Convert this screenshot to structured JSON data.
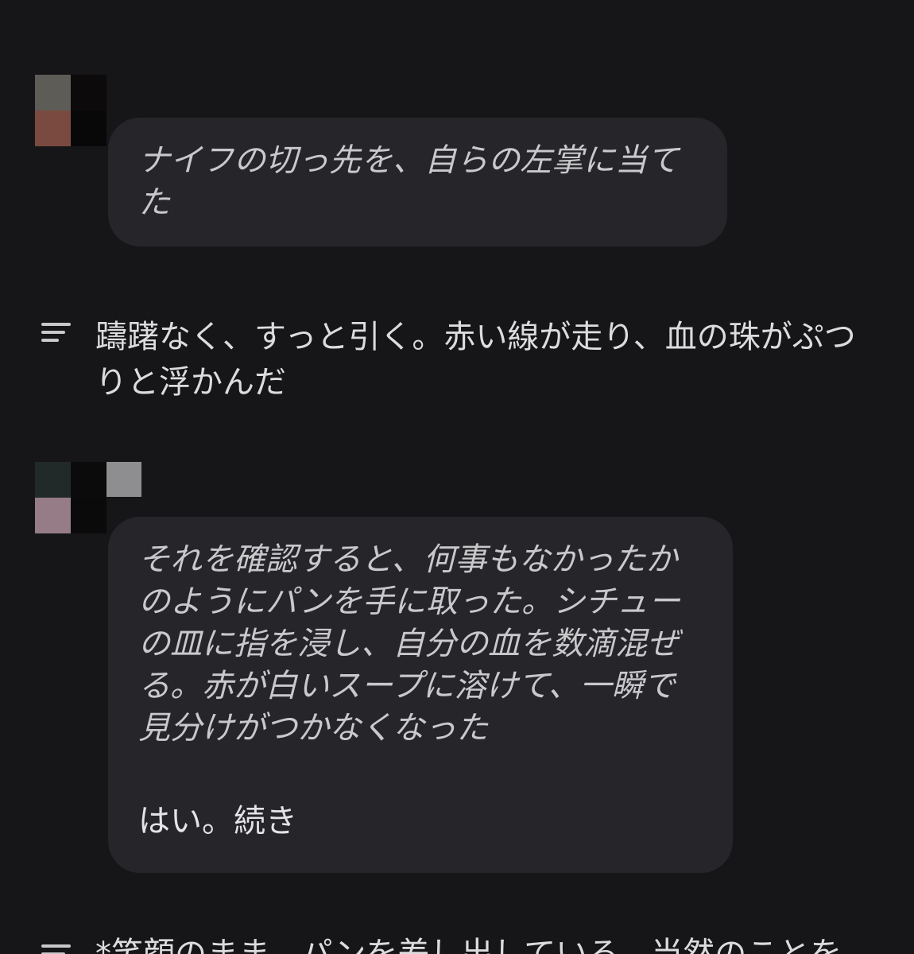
{
  "conversation": {
    "messages": [
      {
        "role": "user",
        "avatar_icon": "user-avatar-icon",
        "italic_text": "ナイフの切っ先を、自らの左掌に当て\nた"
      },
      {
        "role": "assistant",
        "menu_icon": "text-lines-icon",
        "text": "躊躇なく、すっと引く。赤い線が走り、血の珠がぷつりと浮かんだ"
      },
      {
        "role": "user",
        "avatar_icon": "user-avatar-icon",
        "italic_text": "それを確認すると、何事もなかったか\nのようにパンを手に取った。シチュー\nの皿に指を浸し、自分の血を数滴混ぜ\nる。赤が白いスープに溶けて、一瞬で\n見分けがつかなくなった",
        "plain_text": "はい。続き"
      },
      {
        "role": "assistant",
        "menu_icon": "text-lines-icon",
        "text": "*笑顔のまま、パンを差し出している。当然のことを"
      }
    ]
  },
  "colors": {
    "background": "#161618",
    "bubble": "#26262a",
    "text": "#dcdcde"
  }
}
